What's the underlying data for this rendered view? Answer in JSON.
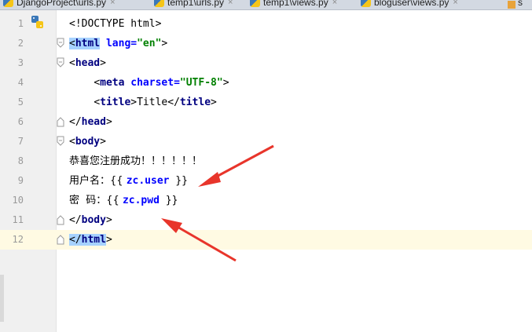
{
  "tabs": [
    {
      "label": "DjangoProject\\urls.py",
      "close": "×"
    },
    {
      "label": "temp1\\urls.py",
      "close": "×"
    },
    {
      "label": "temp1\\views.py",
      "close": "×"
    },
    {
      "label": "bloguser\\views.py",
      "close": "×"
    },
    {
      "label": "s",
      "close": ""
    }
  ],
  "editor": {
    "lines": [
      {
        "num": "1",
        "text": "<!DOCTYPE html>"
      },
      {
        "num": "2",
        "tag_open": "<",
        "tag": "html",
        "attr": " lang=",
        "str": "\"en\"",
        "tag_close": ">"
      },
      {
        "num": "3",
        "tag_open": "<",
        "tag": "head",
        "tag_close": ">"
      },
      {
        "num": "4",
        "indent": "    ",
        "tag_open": "<",
        "tag": "meta",
        "attr": " charset=",
        "str": "\"UTF-8\"",
        "tag_close": ">"
      },
      {
        "num": "5",
        "indent": "    ",
        "open": "<",
        "tag": "title",
        "close": ">",
        "text": "Title",
        "end_open": "</",
        "end_tag": "title",
        "end_close": ">"
      },
      {
        "num": "6",
        "tag_open": "</",
        "tag": "head",
        "tag_close": ">"
      },
      {
        "num": "7",
        "tag_open": "<",
        "tag": "body",
        "tag_close": ">"
      },
      {
        "num": "8",
        "text": "恭喜您注册成功！！！！！！"
      },
      {
        "num": "9",
        "prefix": "用户名：{{ ",
        "var": "zc.user",
        "suffix": " }}"
      },
      {
        "num": "10",
        "prefix": "密  码：{{ ",
        "var": "zc.pwd",
        "suffix": " }}"
      },
      {
        "num": "11",
        "tag_open": "</",
        "tag": "body",
        "tag_close": ">"
      },
      {
        "num": "12",
        "tag_open": "</",
        "tag": "html",
        "tag_close": ">"
      }
    ],
    "current_line": 12
  },
  "colors": {
    "tag": "#000080",
    "attribute": "#0000ff",
    "string": "#008000",
    "arrow": "#e8352b",
    "current_line": "#fffae3",
    "gutter": "#f0f0f0"
  }
}
